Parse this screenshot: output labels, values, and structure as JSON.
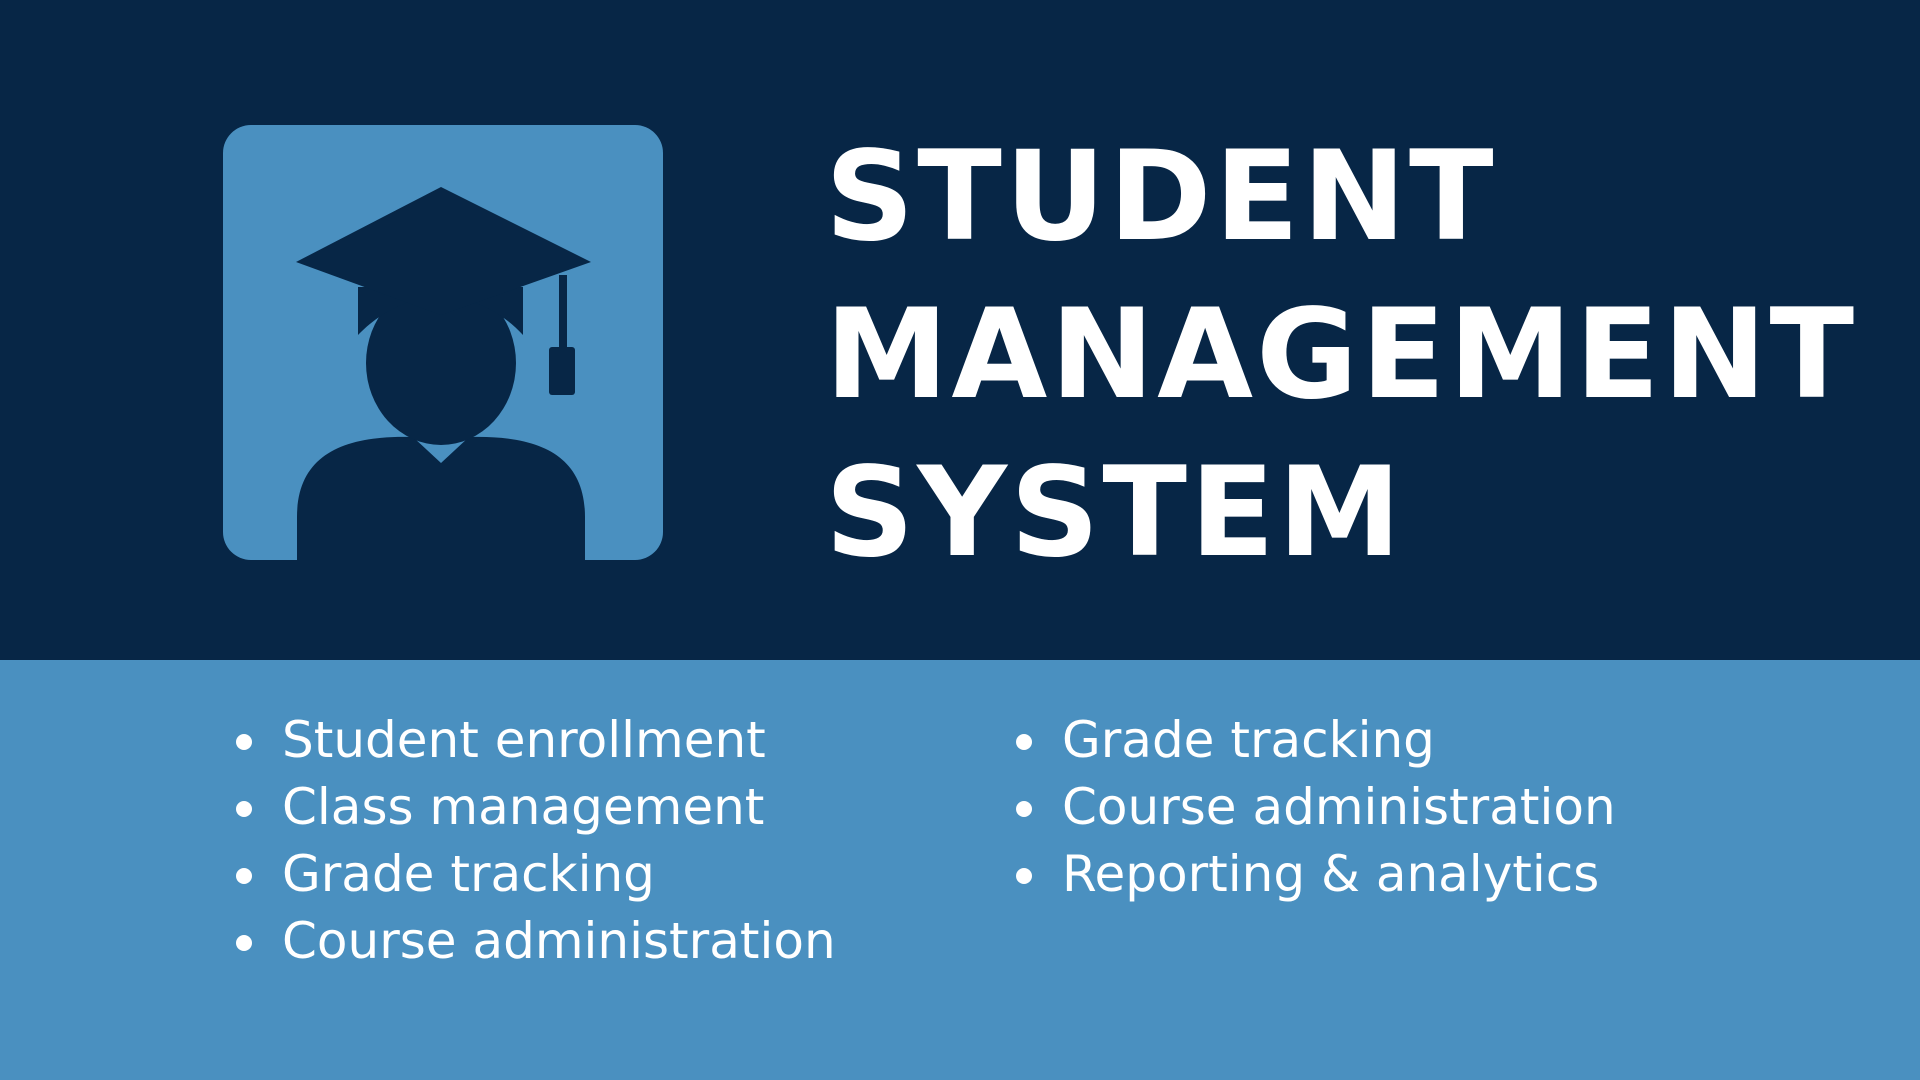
{
  "colors": {
    "header_background": "#072646",
    "footer_background": "#4a90c0",
    "logo_tile": "#4a90c0",
    "logo_figure": "#072646",
    "text": "#ffffff"
  },
  "logo": {
    "icon": "graduate-student-icon"
  },
  "title": {
    "line1": "STUDENT",
    "line2": "MANAGEMENT",
    "line3": "SYSTEM"
  },
  "features": {
    "column1": [
      "Student enrollment",
      "Class management",
      "Grade tracking",
      "Course administration"
    ],
    "column2": [
      "Grade tracking",
      "Course administration",
      "Reporting & analytics"
    ]
  }
}
